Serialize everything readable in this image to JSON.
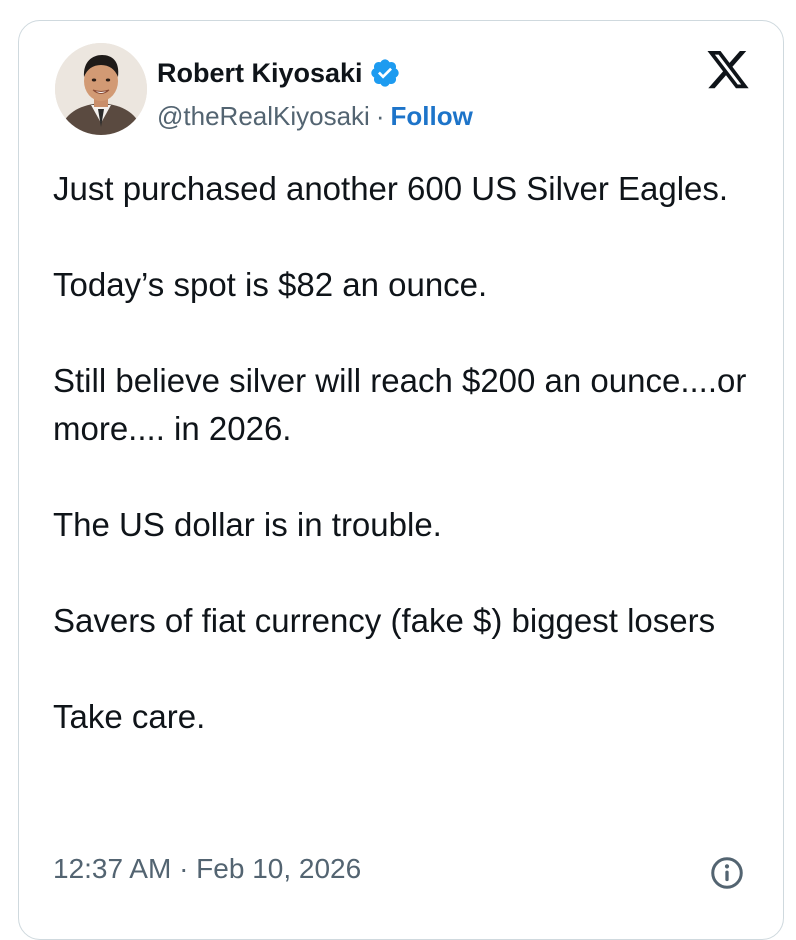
{
  "author": {
    "name": "Robert Kiyosaki",
    "handle": "@theRealKiyosaki",
    "separator": "·",
    "follow_label": "Follow",
    "verified": true,
    "verified_color": "#1d9bf0"
  },
  "icons": {
    "platform_logo": "x-logo-icon",
    "verified_badge": "verified-badge-icon",
    "info": "info-icon"
  },
  "tweet": {
    "paragraphs": [
      "Just purchased another 600 US Silver Eagles.",
      "Today’s spot is $82 an ounce.",
      "Still believe silver will reach $200 an ounce....or more.... in 2026.",
      "The US dollar is in trouble.",
      "Savers of fiat currency (fake $) biggest losers",
      "Take care."
    ],
    "timestamp": "12:37 AM · Feb 10, 2026"
  },
  "colors": {
    "text": "#0f1419",
    "secondary_text": "#536471",
    "follow_link": "#1d74c9",
    "border": "#cfd9de"
  }
}
